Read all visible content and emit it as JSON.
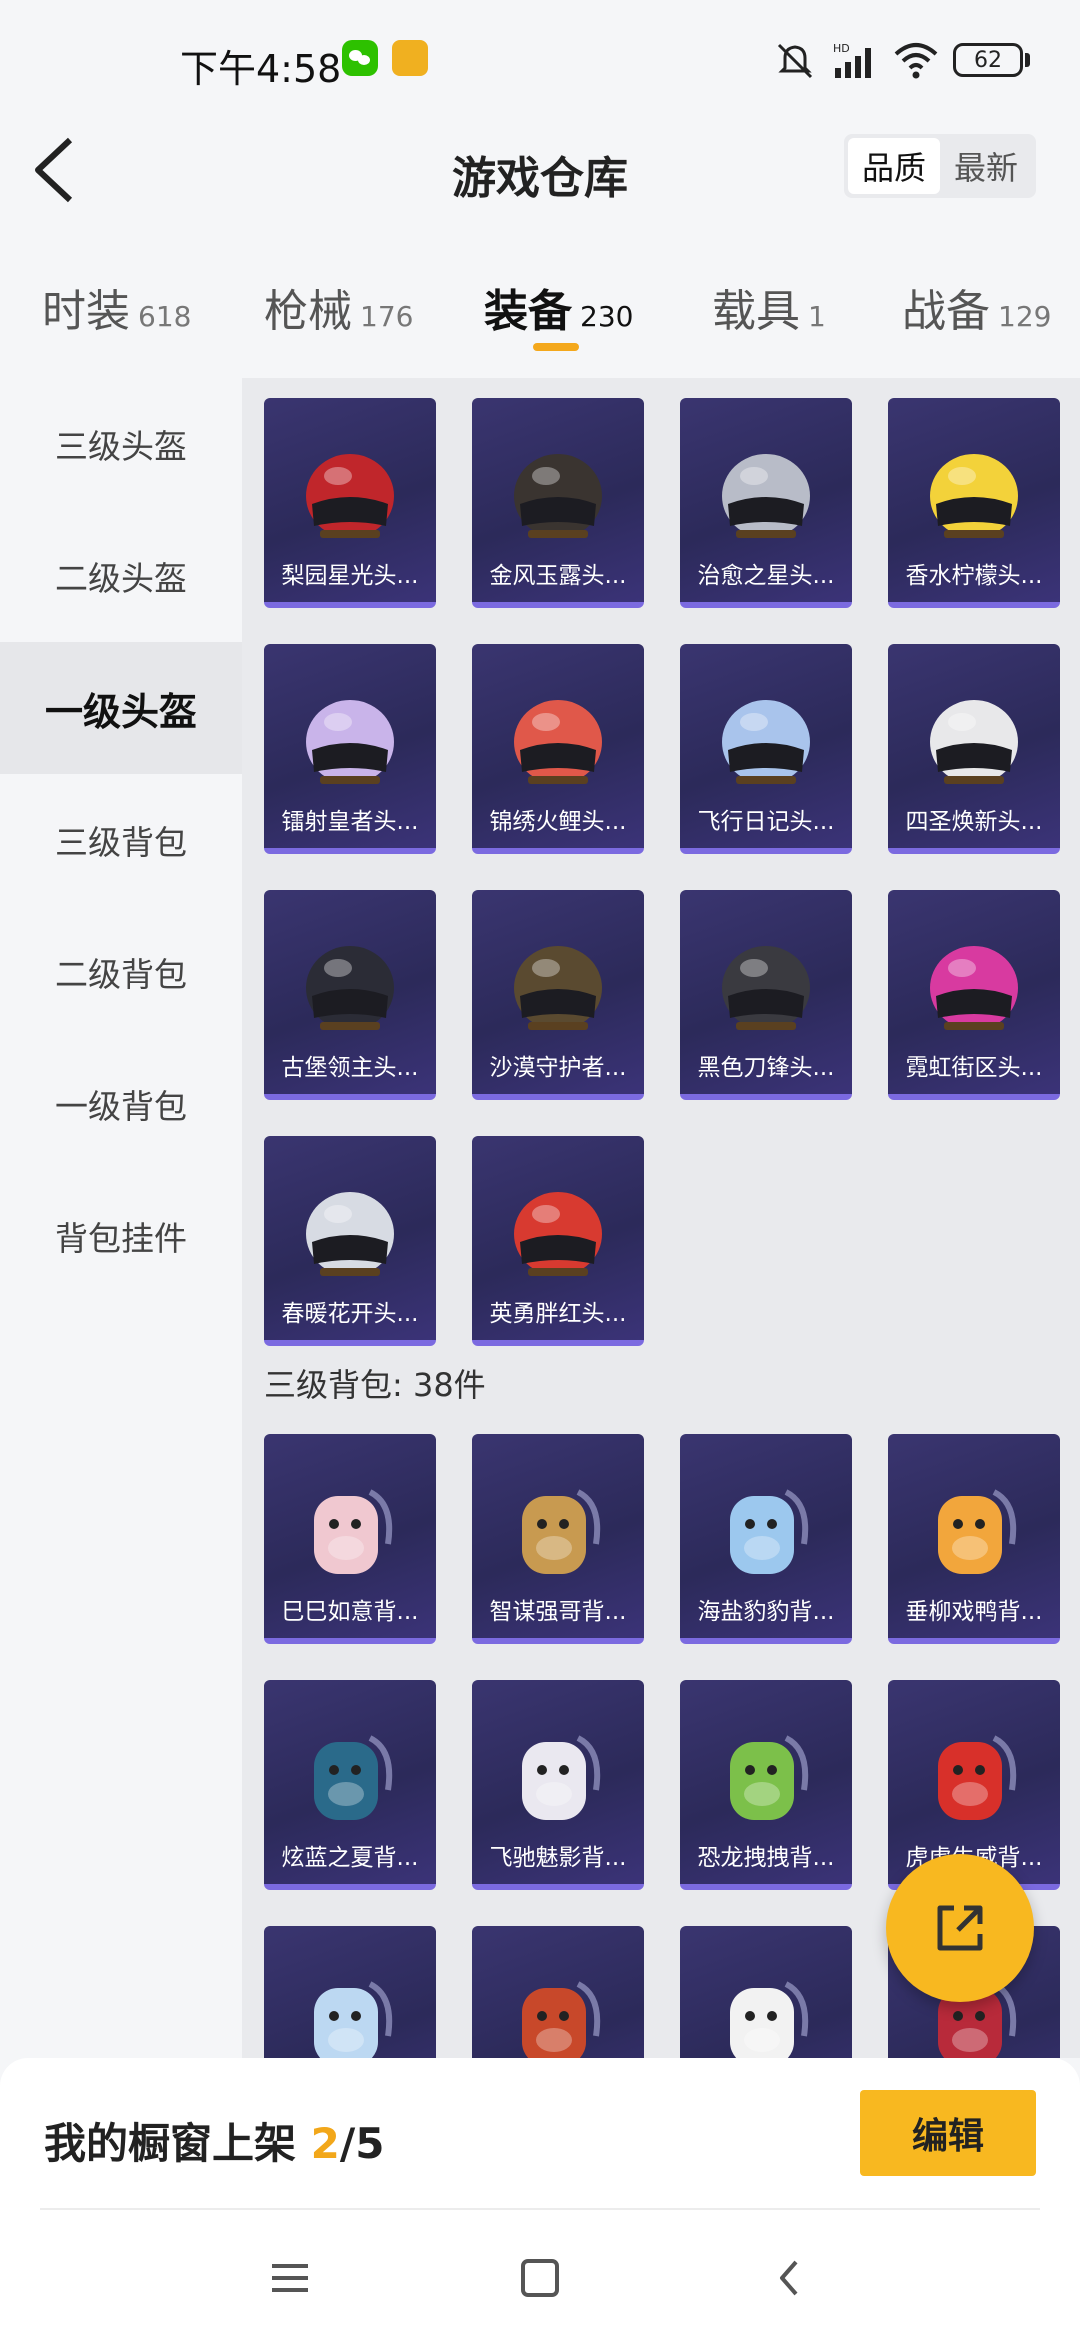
{
  "status_bar": {
    "time": "下午4:58",
    "battery": "62",
    "network": "HD"
  },
  "header": {
    "title": "游戏仓库",
    "sort_options": [
      {
        "label": "品质",
        "active": true
      },
      {
        "label": "最新",
        "active": false
      }
    ]
  },
  "tabs": [
    {
      "label": "时装",
      "count": "618",
      "active": false
    },
    {
      "label": "枪械",
      "count": "176",
      "active": false
    },
    {
      "label": "装备",
      "count": "230",
      "active": true
    },
    {
      "label": "载具",
      "count": "1",
      "active": false
    },
    {
      "label": "战备",
      "count": "129",
      "active": false
    }
  ],
  "sidebar": {
    "items": [
      {
        "label": "三级头盔",
        "active": false
      },
      {
        "label": "二级头盔",
        "active": false
      },
      {
        "label": "一级头盔",
        "active": true
      },
      {
        "label": "三级背包",
        "active": false
      },
      {
        "label": "二级背包",
        "active": false
      },
      {
        "label": "一级背包",
        "active": false
      },
      {
        "label": "背包挂件",
        "active": false
      }
    ]
  },
  "helmets": [
    {
      "name": "梨园星光头...",
      "icon": "helmet-red-icon",
      "color": "#c0262b"
    },
    {
      "name": "金风玉露头...",
      "icon": "helmet-black-gold-icon",
      "color": "#3a3430"
    },
    {
      "name": "治愈之星头...",
      "icon": "helmet-silver-icon",
      "color": "#b8bcc8"
    },
    {
      "name": "香水柠檬头...",
      "icon": "helmet-yellow-icon",
      "color": "#f3d23a"
    },
    {
      "name": "镭射皇者头...",
      "icon": "helmet-lavender-icon",
      "color": "#c9b4ea"
    },
    {
      "name": "锦绣火鲤头...",
      "icon": "helmet-coral-icon",
      "color": "#e0584a"
    },
    {
      "name": "飞行日记头...",
      "icon": "helmet-light-blue-icon",
      "color": "#a9c4ec"
    },
    {
      "name": "四圣焕新头...",
      "icon": "helmet-white-icon",
      "color": "#e8e8ea"
    },
    {
      "name": "古堡领主头...",
      "icon": "helmet-knight-icon",
      "color": "#2b2c36"
    },
    {
      "name": "沙漠守护者...",
      "icon": "helmet-desert-icon",
      "color": "#5a4a30"
    },
    {
      "name": "黑色刀锋头...",
      "icon": "helmet-black-icon",
      "color": "#3a3a40"
    },
    {
      "name": "霓虹街区头...",
      "icon": "helmet-pink-icon",
      "color": "#d83aa0"
    },
    {
      "name": "春暖花开头...",
      "icon": "helmet-flower-icon",
      "color": "#d7dbe3"
    },
    {
      "name": "英勇胖红头...",
      "icon": "helmet-red-bird-icon",
      "color": "#d83a30"
    }
  ],
  "backpack_section": {
    "label": "三级背包: 38件"
  },
  "backpacks": [
    {
      "name": "巳巳如意背...",
      "icon": "backpack-pink-icon",
      "color": "#f0c8d0"
    },
    {
      "name": "智谋强哥背...",
      "icon": "backpack-pig-icon",
      "color": "#c89a50"
    },
    {
      "name": "海盐豹豹背...",
      "icon": "backpack-seal-icon",
      "color": "#9cc8ee"
    },
    {
      "name": "垂柳戏鸭背...",
      "icon": "backpack-duck-icon",
      "color": "#f2a63c"
    },
    {
      "name": "炫蓝之夏背...",
      "icon": "backpack-blue-icon",
      "color": "#2a6a8a"
    },
    {
      "name": "飞驰魅影背...",
      "icon": "backpack-white-icon",
      "color": "#eae8f0"
    },
    {
      "name": "恐龙拽拽背...",
      "icon": "backpack-dino-icon",
      "color": "#7cc04a"
    },
    {
      "name": "虎虎生威背...",
      "icon": "backpack-tiger-icon",
      "color": "#d8302a"
    },
    {
      "name": "",
      "icon": "backpack-light-blue-icon",
      "color": "#bcd8f2"
    },
    {
      "name": "",
      "icon": "backpack-dragon-icon",
      "color": "#c8482a"
    },
    {
      "name": "",
      "icon": "backpack-bunny-icon",
      "color": "#f2f2f2"
    },
    {
      "name": "",
      "icon": "backpack-red-icon",
      "color": "#b82a3a"
    }
  ],
  "bottom": {
    "showcase_prefix": "我的橱窗上架 ",
    "showcase_current": "2",
    "showcase_total": "/5",
    "edit_label": "编辑"
  },
  "colors": {
    "accent": "#f8b820",
    "card_bg": "#2c2a5a",
    "card_border": "#7b6ae0"
  }
}
